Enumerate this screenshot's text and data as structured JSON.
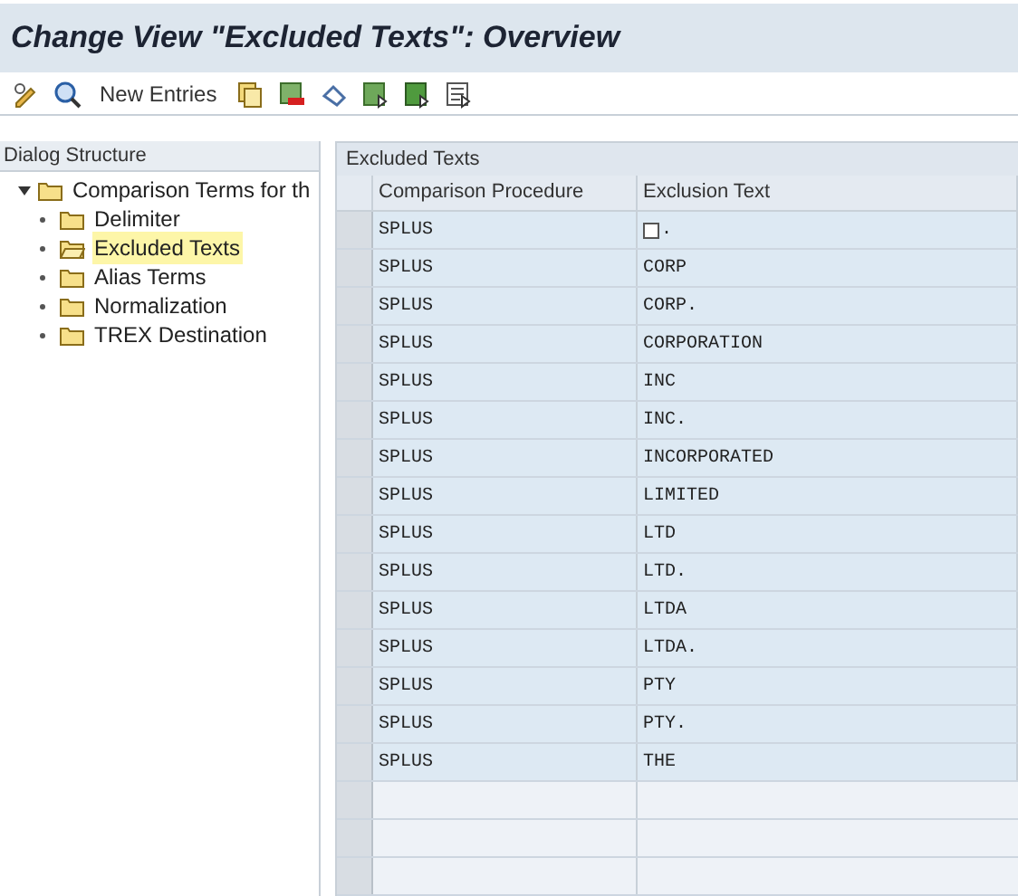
{
  "window": {
    "title": "Change View \"Excluded Texts\": Overview"
  },
  "toolbar": {
    "new_entries": "New Entries"
  },
  "dialog_structure": {
    "title": "Dialog Structure",
    "items": [
      {
        "label": "Comparison Terms for th",
        "expanded": true,
        "selected": false,
        "children": [
          {
            "label": "Delimiter",
            "selected": false
          },
          {
            "label": "Excluded Texts",
            "selected": true
          },
          {
            "label": "Alias Terms",
            "selected": false
          },
          {
            "label": "Normalization",
            "selected": false
          },
          {
            "label": "TREX Destination",
            "selected": false
          }
        ]
      }
    ]
  },
  "table": {
    "title": "Excluded Texts",
    "columns": [
      "Comparison Procedure",
      "Exclusion Text"
    ],
    "rows": [
      [
        "SPLUS",
        "."
      ],
      [
        "SPLUS",
        "CORP"
      ],
      [
        "SPLUS",
        "CORP."
      ],
      [
        "SPLUS",
        "CORPORATION"
      ],
      [
        "SPLUS",
        "INC"
      ],
      [
        "SPLUS",
        "INC."
      ],
      [
        "SPLUS",
        "INCORPORATED"
      ],
      [
        "SPLUS",
        "LIMITED"
      ],
      [
        "SPLUS",
        "LTD"
      ],
      [
        "SPLUS",
        "LTD."
      ],
      [
        "SPLUS",
        "LTDA"
      ],
      [
        "SPLUS",
        "LTDA."
      ],
      [
        "SPLUS",
        "PTY"
      ],
      [
        "SPLUS",
        "PTY."
      ],
      [
        "SPLUS",
        "THE"
      ]
    ]
  }
}
